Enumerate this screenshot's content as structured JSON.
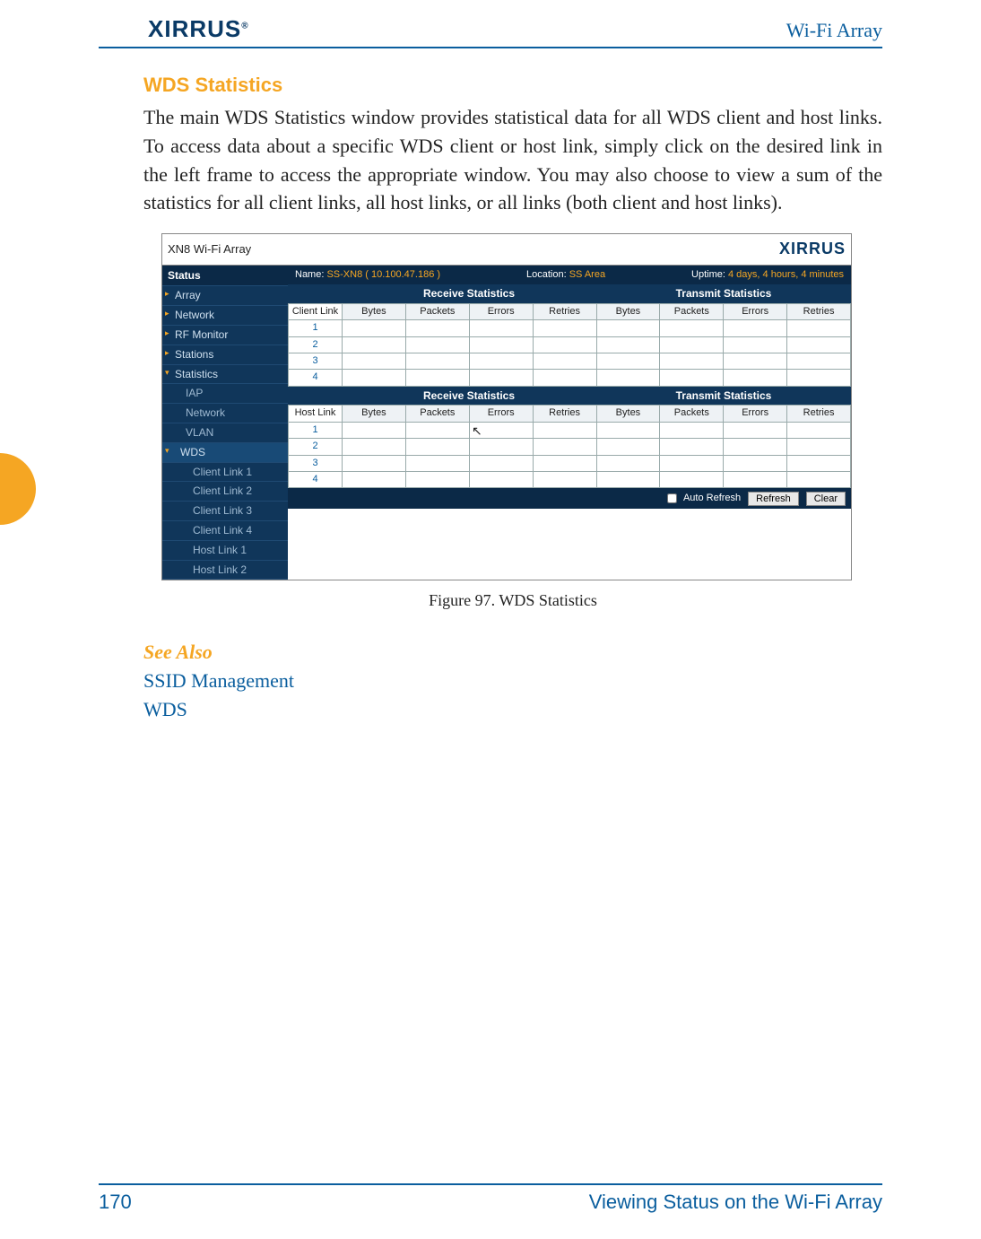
{
  "header": {
    "logo": "XIRRUS",
    "product": "Wi-Fi Array"
  },
  "section_title": "WDS Statistics",
  "body_para": "The main WDS Statistics window provides statistical data for all WDS client and host links. To access data about a specific WDS client or host link, simply click on the desired link in the left frame to access the appropriate window. You may also choose to view a sum of the statistics for all client links, all host links, or all links (both client and host links).",
  "screenshot": {
    "window_title": "XN8 Wi-Fi Array",
    "brand": "XIRRUS",
    "sidebar": {
      "heading": "Status",
      "items": [
        "Array",
        "Network",
        "RF Monitor",
        "Stations",
        "Statistics"
      ],
      "stats_children": [
        "IAP",
        "Network",
        "VLAN"
      ],
      "wds_label": "WDS",
      "wds_children": [
        "Client Link 1",
        "Client Link 2",
        "Client Link 3",
        "Client Link 4",
        "Host Link 1",
        "Host Link 2"
      ]
    },
    "info": {
      "name_label": "Name:",
      "name_value": "SS-XN8   ( 10.100.47.186 )",
      "loc_label": "Location:",
      "loc_value": "SS Area",
      "up_label": "Uptime:",
      "up_value": "4 days, 4 hours, 4 minutes"
    },
    "group_rx": "Receive Statistics",
    "group_tx": "Transmit Statistics",
    "cols": [
      "Bytes",
      "Packets",
      "Errors",
      "Retries"
    ],
    "client_head": "Client Link",
    "host_head": "Host Link",
    "rows": [
      "1",
      "2",
      "3",
      "4"
    ],
    "auto_refresh": "Auto Refresh",
    "btn_refresh": "Refresh",
    "btn_clear": "Clear"
  },
  "figure_caption": "Figure 97. WDS Statistics",
  "see_also": {
    "heading": "See Also",
    "links": [
      "SSID Management",
      "WDS"
    ]
  },
  "footer": {
    "page_no": "170",
    "chapter": "Viewing Status on the Wi-Fi Array"
  }
}
